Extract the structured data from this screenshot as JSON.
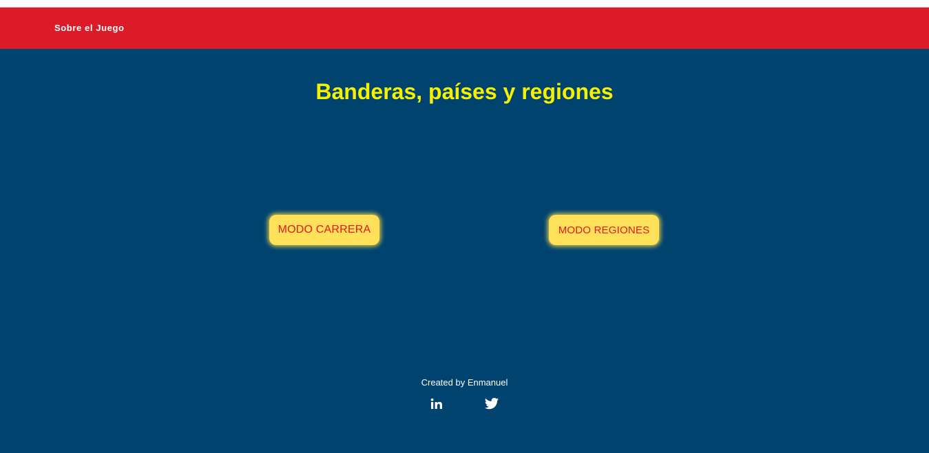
{
  "navbar": {
    "link_label": "Sobre el Juego",
    "background_color": "#db1b28"
  },
  "main": {
    "title": "Banderas, países y regiones",
    "title_color": "#f6f100",
    "background_color": "#00436f",
    "buttons": [
      {
        "label": "MODO CARRERA"
      },
      {
        "label": "MODO REGIONES"
      }
    ],
    "button_color": "#ffe159",
    "button_text_color": "#e2161f"
  },
  "footer": {
    "credit": "Created by Enmanuel",
    "icons": [
      "linkedin-icon",
      "twitter-icon"
    ]
  }
}
